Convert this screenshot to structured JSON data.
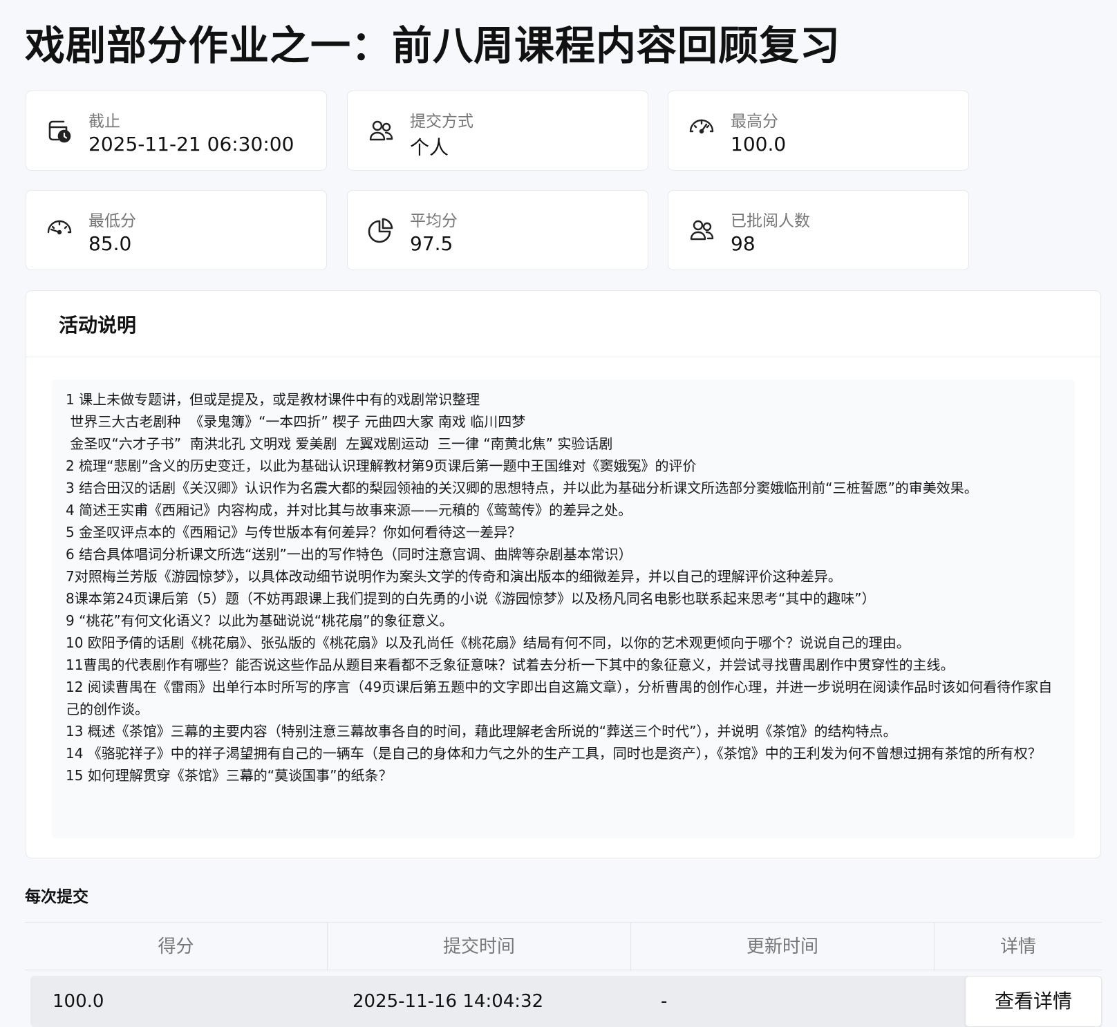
{
  "page": {
    "title": "戏剧部分作业之一：前八周课程内容回顾复习"
  },
  "stats": [
    {
      "label": "截止",
      "value": "2025-11-21 06:30:00",
      "icon": "calendar-clock-icon"
    },
    {
      "label": "提交方式",
      "value": "个人",
      "icon": "users-icon"
    },
    {
      "label": "最高分",
      "value": "100.0",
      "icon": "gauge-high-icon"
    },
    {
      "label": "最低分",
      "value": "85.0",
      "icon": "gauge-low-icon"
    },
    {
      "label": "平均分",
      "value": "97.5",
      "icon": "pie-chart-icon"
    },
    {
      "label": "已批阅人数",
      "value": "98",
      "icon": "users-icon"
    }
  ],
  "description": {
    "heading": "活动说明",
    "lines": [
      "1 课上未做专题讲，但或是提及，或是教材课件中有的戏剧常识整理",
      " 世界三大古老剧种  《录鬼簿》“一本四折” 楔子 元曲四大家 南戏 临川四梦",
      " 金圣叹“六才子书”  南洪北孔 文明戏 爱美剧  左翼戏剧运动  三一律 “南黄北焦” 实验话剧",
      "2 梳理“悲剧”含义的历史变迁，以此为基础认识理解教材第9页课后第一题中王国维对《窦娥冤》的评价",
      "3 结合田汉的话剧《关汉卿》认识作为名震大都的梨园领袖的关汉卿的思想特点，并以此为基础分析课文所选部分窦娥临刑前“三桩誓愿”的审美效果。",
      "4 简述王实甫《西厢记》内容构成，并对比其与故事来源——元稹的《莺莺传》的差异之处。",
      "5 金圣叹评点本的《西厢记》与传世版本有何差异？你如何看待这一差异？",
      "6 结合具体唱词分析课文所选“送别”一出的写作特色（同时注意宫调、曲牌等杂剧基本常识）",
      "7对照梅兰芳版《游园惊梦》，以具体改动细节说明作为案头文学的传奇和演出版本的细微差异，并以自己的理解评价这种差异。",
      "8课本第24页课后第（5）题（不妨再跟课上我们提到的白先勇的小说《游园惊梦》以及杨凡同名电影也联系起来思考“其中的趣味”）",
      "9 “桃花”有何文化语义？以此为基础说说“桃花扇”的象征意义。",
      "10 欧阳予倩的话剧《桃花扇》、张弘版的《桃花扇》以及孔尚任《桃花扇》结局有何不同，以你的艺术观更倾向于哪个？说说自己的理由。",
      "11曹禺的代表剧作有哪些？能否说这些作品从题目来看都不乏象征意味？试着去分析一下其中的象征意义，并尝试寻找曹禺剧作中贯穿性的主线。",
      "12 阅读曹禺在《雷雨》出单行本时所写的序言（49页课后第五题中的文字即出自这篇文章），分析曹禺的创作心理，并进一步说明在阅读作品时该如何看待作家自己的创作谈。",
      "13 概述《茶馆》三幕的主要内容（特别注意三幕故事各自的时间，藉此理解老舍所说的“葬送三个时代”），并说明《茶馆》的结构特点。",
      "14 《骆驼祥子》中的祥子渴望拥有自己的一辆车（是自己的身体和力气之外的生产工具，同时也是资产），《茶馆》中的王利发为何不曾想过拥有茶馆的所有权？",
      "15 如何理解贯穿《茶馆》三幕的“莫谈国事”的纸条？"
    ]
  },
  "submissions": {
    "heading": "每次提交",
    "columns": [
      "得分",
      "提交时间",
      "更新时间",
      "详情"
    ],
    "rows": [
      {
        "score": "100.0",
        "submitted": "2025-11-16 14:04:32",
        "updated": "-",
        "action": "查看详情"
      }
    ]
  }
}
